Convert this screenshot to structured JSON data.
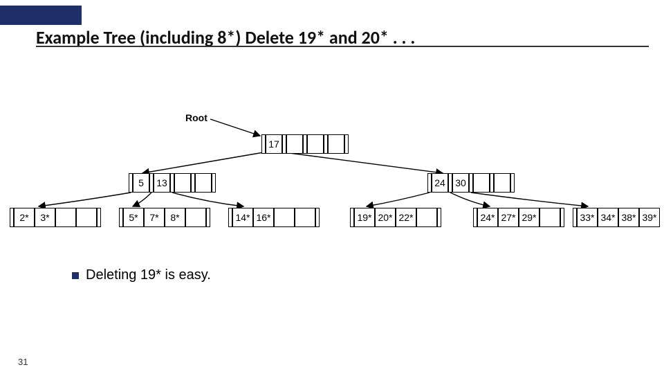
{
  "title": "Example Tree (including 8*)  Delete 19* and 20* . . .",
  "root_label": "Root",
  "root_node": {
    "keys": [
      "17",
      "",
      "",
      ""
    ]
  },
  "inner_left": {
    "keys": [
      "5",
      "13",
      "",
      ""
    ]
  },
  "inner_right": {
    "keys": [
      "24",
      "30",
      "",
      ""
    ]
  },
  "leaves": [
    {
      "entries": [
        "2*",
        "3*",
        "",
        ""
      ]
    },
    {
      "entries": [
        "5*",
        "7*",
        "8*",
        ""
      ]
    },
    {
      "entries": [
        "14*",
        "16*",
        "",
        ""
      ]
    },
    {
      "entries": [
        "19*",
        "20*",
        "22*",
        ""
      ]
    },
    {
      "entries": [
        "24*",
        "27*",
        "29*",
        ""
      ]
    },
    {
      "entries": [
        "33*",
        "34*",
        "38*",
        "39*"
      ]
    }
  ],
  "bullet": "Deleting 19* is easy.",
  "page_number": "31",
  "chart_data": {
    "type": "table",
    "description": "B+ tree example with root key 17; left inner node keys 5,13; right inner node keys 24,30; six leaf nodes with entries 2*,3* / 5*,7*,8* / 14*,16* / 19*,20*,22* / 24*,27*,29* / 33*,34*,38*,39*",
    "root": [
      17
    ],
    "level1": [
      [
        5,
        13
      ],
      [
        24,
        30
      ]
    ],
    "leaves": [
      [
        "2*",
        "3*"
      ],
      [
        "5*",
        "7*",
        "8*"
      ],
      [
        "14*",
        "16*"
      ],
      [
        "19*",
        "20*",
        "22*"
      ],
      [
        "24*",
        "27*",
        "29*"
      ],
      [
        "33*",
        "34*",
        "38*",
        "39*"
      ]
    ]
  }
}
